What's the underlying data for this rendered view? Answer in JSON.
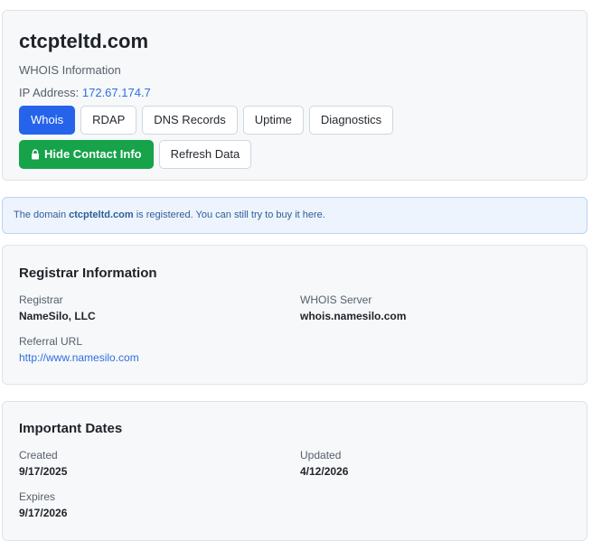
{
  "header": {
    "domain": "ctcpteltd.com",
    "subtitle": "WHOIS Information",
    "ip_label": "IP Address:",
    "ip_value": "172.67.174.7",
    "buttons": {
      "whois": "Whois",
      "rdap": "RDAP",
      "dns": "DNS Records",
      "uptime": "Uptime",
      "diagnostics": "Diagnostics",
      "contact": "Hide Contact Info",
      "refresh": "Refresh Data"
    }
  },
  "notice": {
    "prefix": "The domain ",
    "domain": "ctcpteltd.com",
    "middle": " is registered. You can still try to buy it ",
    "link": "here",
    "suffix": "."
  },
  "registrar": {
    "title": "Registrar Information",
    "registrar_label": "Registrar",
    "registrar_value": "NameSilo, LLC",
    "whois_server_label": "WHOIS Server",
    "whois_server_value": "whois.namesilo.com",
    "referral_label": "Referral URL",
    "referral_value": "http://www.namesilo.com"
  },
  "dates": {
    "title": "Important Dates",
    "created_label": "Created",
    "created_value": "9/17/2025",
    "updated_label": "Updated",
    "updated_value": "4/12/2026",
    "expires_label": "Expires",
    "expires_value": "9/17/2026"
  },
  "colors": {
    "primary": "#2563eb",
    "success": "#16a34a",
    "link": "#2f6fdf"
  },
  "icons": {
    "contact_button": "lock-icon"
  }
}
